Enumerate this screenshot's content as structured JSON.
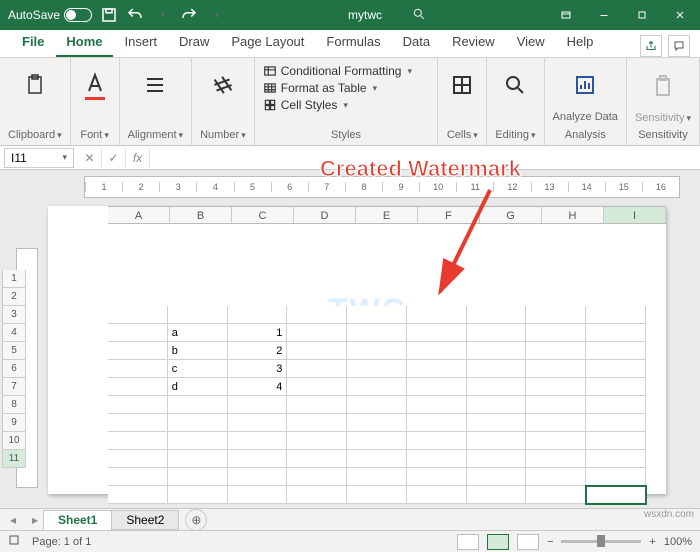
{
  "titlebar": {
    "autosave": "AutoSave",
    "filename": "mytwc"
  },
  "tabs": {
    "file": "File",
    "home": "Home",
    "insert": "Insert",
    "draw": "Draw",
    "page_layout": "Page Layout",
    "formulas": "Formulas",
    "data": "Data",
    "review": "Review",
    "view": "View",
    "help": "Help"
  },
  "ribbon": {
    "clipboard": "Clipboard",
    "font": "Font",
    "alignment": "Alignment",
    "number": "Number",
    "styles": "Styles",
    "cond_fmt": "Conditional Formatting",
    "fmt_table": "Format as Table",
    "cell_styles": "Cell Styles",
    "cells": "Cells",
    "editing": "Editing",
    "analyze": "Analyze Data",
    "analysis": "Analysis",
    "sensitivity": "Sensitivity",
    "sensitivity_grp": "Sensitivity"
  },
  "formula_bar": {
    "cell_ref": "I11",
    "fx": "fx",
    "value": ""
  },
  "callout": "Created Watermark",
  "columns": [
    "A",
    "B",
    "C",
    "D",
    "E",
    "F",
    "G",
    "H",
    "I"
  ],
  "rows": [
    "1",
    "2",
    "3",
    "4",
    "5",
    "6",
    "7",
    "8",
    "9",
    "10",
    "11"
  ],
  "ruler_marks": [
    "1",
    "2",
    "3",
    "4",
    "5",
    "6",
    "7",
    "8",
    "9",
    "10",
    "11",
    "12",
    "13",
    "14",
    "15",
    "16"
  ],
  "data_rows": [
    {
      "b": "a",
      "c": "1"
    },
    {
      "b": "b",
      "c": "2"
    },
    {
      "b": "c",
      "c": "3"
    },
    {
      "b": "d",
      "c": "4"
    }
  ],
  "watermark_text": "TWC",
  "sheets": {
    "s1": "Sheet1",
    "s2": "Sheet2"
  },
  "status": {
    "page": "Page: 1 of 1",
    "zoom": "100%"
  },
  "attribution": "wsxdn.com"
}
